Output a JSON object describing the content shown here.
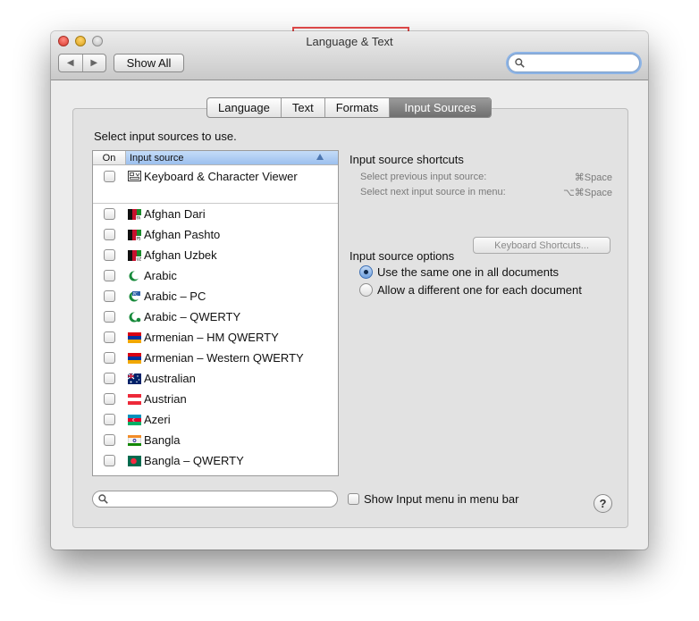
{
  "window": {
    "title": "Language & Text",
    "show_all_label": "Show All",
    "nav_back": "◀",
    "nav_forward": "▶",
    "search_placeholder": ""
  },
  "tabs": [
    {
      "label": "Language",
      "active": false
    },
    {
      "label": "Text",
      "active": false
    },
    {
      "label": "Formats",
      "active": false
    },
    {
      "label": "Input Sources",
      "active": true
    }
  ],
  "instructions": "Select input sources to use.",
  "list": {
    "col_on": "On",
    "col_source": "Input source",
    "items": [
      {
        "label": "Keyboard & Character Viewer",
        "icon": "keyboard-viewer-icon",
        "checked": false
      },
      {
        "label": "Afghan Dari",
        "icon": "afghanistan-flag-icon",
        "checked": false
      },
      {
        "label": "Afghan Pashto",
        "icon": "afghanistan-flag-icon",
        "checked": false
      },
      {
        "label": "Afghan Uzbek",
        "icon": "afghanistan-flag-icon",
        "checked": false
      },
      {
        "label": "Arabic",
        "icon": "crescent-icon",
        "checked": false
      },
      {
        "label": "Arabic – PC",
        "icon": "crescent-pc-icon",
        "checked": false
      },
      {
        "label": "Arabic – QWERTY",
        "icon": "crescent-icon",
        "checked": false
      },
      {
        "label": "Armenian – HM QWERTY",
        "icon": "armenia-flag-icon",
        "checked": false
      },
      {
        "label": "Armenian – Western QWERTY",
        "icon": "armenia-flag-icon",
        "checked": false
      },
      {
        "label": "Australian",
        "icon": "australia-flag-icon",
        "checked": false
      },
      {
        "label": "Austrian",
        "icon": "austria-flag-icon",
        "checked": false
      },
      {
        "label": "Azeri",
        "icon": "azerbaijan-flag-icon",
        "checked": false
      },
      {
        "label": "Bangla",
        "icon": "bangla-icon",
        "checked": false
      },
      {
        "label": "Bangla – QWERTY",
        "icon": "bangladesh-flag-icon",
        "checked": false
      }
    ]
  },
  "shortcuts": {
    "heading": "Input source shortcuts",
    "prev_label": "Select previous input source:",
    "prev_key": "⌘Space",
    "next_label": "Select next input source in menu:",
    "next_key": "⌥⌘Space",
    "button_label": "Keyboard Shortcuts..."
  },
  "options": {
    "heading": "Input source options",
    "same_label": "Use the same one in all documents",
    "different_label": "Allow a different one for each document",
    "selected": "same"
  },
  "bottom": {
    "search_placeholder": "",
    "show_menu_label": "Show Input menu in menu bar",
    "show_menu_checked": false,
    "help_label": "?"
  },
  "colors": {
    "accent": "#6fa0dd",
    "highlight_box": "#e84c4c",
    "tab_active": "#7a7a7a"
  }
}
